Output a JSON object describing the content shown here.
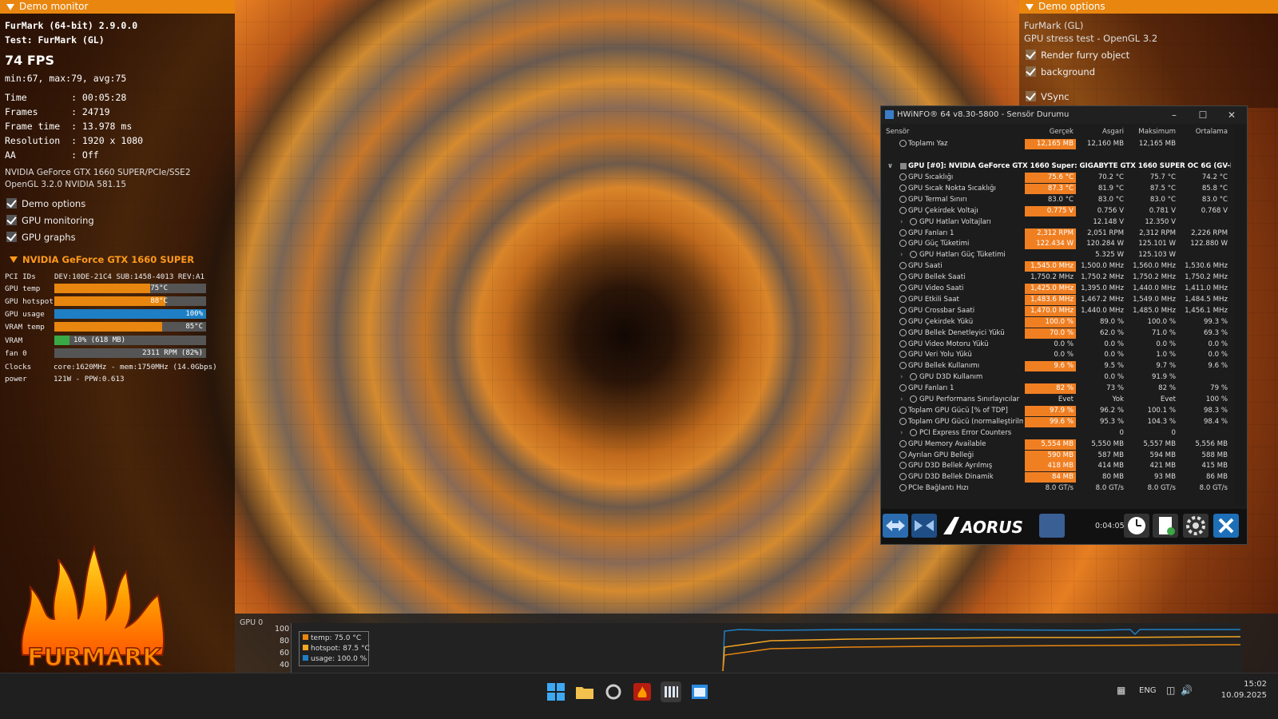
{
  "left_panel": {
    "title": "Demo monitor",
    "app": "FurMark (64-bit) 2.9.0.0",
    "test": "Test: FurMark (GL)",
    "fps": "74 FPS",
    "fps_stats": "min:67, max:79, avg:75",
    "time": "Time        : 00:05:28",
    "frames": "Frames      : 24719",
    "frame_time": "Frame time  : 13.978 ms",
    "resolution": "Resolution  : 1920 x 1080",
    "aa": "AA          : Off",
    "gpu_info": "NVIDIA GeForce GTX 1660 SUPER/PCIe/SSE2",
    "gl_info": "OpenGL 3.2.0 NVIDIA 581.15",
    "checks": [
      "Demo options",
      "GPU monitoring",
      "GPU graphs"
    ],
    "gpu_header": "NVIDIA GeForce GTX 1660 SUPER",
    "pci_label": "PCI IDs",
    "pci_value": "DEV:10DE-21C4 SUB:1458-4013 REV:A1",
    "bars": [
      {
        "label": "GPU temp",
        "text": "75°C",
        "fill": 0.63,
        "color": "#e8860f"
      },
      {
        "label": "GPU hotspot",
        "text": "88°C",
        "fill": 0.73,
        "color": "#e8860f"
      },
      {
        "label": "GPU usage",
        "text": "100%",
        "fill": 1.0,
        "color": "#1f7fc4"
      },
      {
        "label": "VRAM temp",
        "text": "85°C",
        "fill": 0.71,
        "color": "#e8860f"
      },
      {
        "label": "VRAM",
        "text": "10% (618 MB)",
        "fill": 0.1,
        "color": "#3aa845"
      },
      {
        "label": "fan 0",
        "text": "2311 RPM (82%)",
        "fill": 0.0,
        "color": "#777"
      }
    ],
    "clocks_label": "Clocks",
    "clocks_value": "core:1620MHz - mem:1750MHz (14.0Gbps)",
    "power_label": "power",
    "power_value": "121W - PPW:0.613",
    "logo_text": "FURMARK"
  },
  "right_panel": {
    "title": "Demo options",
    "line1": "FurMark (GL)",
    "line2": "GPU stress test - OpenGL 3.2",
    "checks": [
      "Render furry object",
      "background",
      "VSync"
    ]
  },
  "hwinfo": {
    "title": "HWiNFO® 64 v8.30-5800 - Sensör Durumu",
    "columns": [
      "Sensör",
      "Gerçek",
      "Asgari",
      "Maksimum",
      "Ortalama"
    ],
    "top_row": {
      "name": "Toplamı Yaz",
      "vals": [
        "12,165 MB",
        "12,160 MB",
        "12,165 MB",
        ""
      ]
    },
    "group": "GPU [#0]: NVIDIA GeForce GTX 1660 Super: GIGABYTE GTX 1660 SUPER OC 6G (GV-N16...",
    "rows": [
      {
        "name": "GPU Sıcaklığı",
        "vals": [
          "75.6 °C",
          "70.2 °C",
          "75.7 °C",
          "74.2 °C"
        ],
        "hl": true
      },
      {
        "name": "GPU Sıcak Nokta Sıcaklığı",
        "vals": [
          "87.3 °C",
          "81.9 °C",
          "87.5 °C",
          "85.8 °C"
        ],
        "hl": true
      },
      {
        "name": "GPU Termal Sınırı",
        "vals": [
          "83.0 °C",
          "83.0 °C",
          "83.0 °C",
          "83.0 °C"
        ],
        "hl": false
      },
      {
        "name": "GPU Çekirdek Voltajı",
        "vals": [
          "0.775 V",
          "0.756 V",
          "0.781 V",
          "0.768 V"
        ],
        "hl": true
      },
      {
        "name": "GPU Hatları Voltajları",
        "vals": [
          "",
          "12.148 V",
          "12.350 V",
          ""
        ],
        "hl": false,
        "sub": true
      },
      {
        "name": "GPU Fanları 1",
        "vals": [
          "2,312 RPM",
          "2,051 RPM",
          "2,312 RPM",
          "2,226 RPM"
        ],
        "hl": true
      },
      {
        "name": "GPU Güç Tüketimi",
        "vals": [
          "122.434 W",
          "120.284 W",
          "125.101 W",
          "122.880 W"
        ],
        "hl": true
      },
      {
        "name": "GPU Hatları Güç Tüketimi",
        "vals": [
          "",
          "5.325 W",
          "125.103 W",
          ""
        ],
        "hl": false,
        "sub": true
      },
      {
        "name": "GPU Saati",
        "vals": [
          "1,545.0 MHz",
          "1,500.0 MHz",
          "1,560.0 MHz",
          "1,530.6 MHz"
        ],
        "hl": true
      },
      {
        "name": "GPU Bellek Saati",
        "vals": [
          "1,750.2 MHz",
          "1,750.2 MHz",
          "1,750.2 MHz",
          "1,750.2 MHz"
        ],
        "hl": false
      },
      {
        "name": "GPU Video Saati",
        "vals": [
          "1,425.0 MHz",
          "1,395.0 MHz",
          "1,440.0 MHz",
          "1,411.0 MHz"
        ],
        "hl": true
      },
      {
        "name": "GPU Etkili Saat",
        "vals": [
          "1,483.6 MHz",
          "1,467.2 MHz",
          "1,549.0 MHz",
          "1,484.5 MHz"
        ],
        "hl": true
      },
      {
        "name": "GPU Crossbar Saati",
        "vals": [
          "1,470.0 MHz",
          "1,440.0 MHz",
          "1,485.0 MHz",
          "1,456.1 MHz"
        ],
        "hl": true
      },
      {
        "name": "GPU Çekirdek Yükü",
        "vals": [
          "100.0 %",
          "89.0 %",
          "100.0 %",
          "99.3 %"
        ],
        "hl": true
      },
      {
        "name": "GPU Bellek Denetleyici Yükü",
        "vals": [
          "70.0 %",
          "62.0 %",
          "71.0 %",
          "69.3 %"
        ],
        "hl": true
      },
      {
        "name": "GPU Video Motoru Yükü",
        "vals": [
          "0.0 %",
          "0.0 %",
          "0.0 %",
          "0.0 %"
        ],
        "hl": false
      },
      {
        "name": "GPU Veri Yolu Yükü",
        "vals": [
          "0.0 %",
          "0.0 %",
          "1.0 %",
          "0.0 %"
        ],
        "hl": false
      },
      {
        "name": "GPU Bellek Kullanımı",
        "vals": [
          "9.6 %",
          "9.5 %",
          "9.7 %",
          "9.6 %"
        ],
        "hl": true
      },
      {
        "name": "GPU D3D Kullanım",
        "vals": [
          "",
          "0.0 %",
          "91.9 %",
          ""
        ],
        "hl": false,
        "sub": true
      },
      {
        "name": "GPU Fanları 1",
        "vals": [
          "82 %",
          "73 %",
          "82 %",
          "79 %"
        ],
        "hl": true
      },
      {
        "name": "GPU Performans Sınırlayıcılar",
        "vals": [
          "Evet",
          "Yok",
          "Evet",
          "100 %"
        ],
        "hl": false,
        "sub": true
      },
      {
        "name": "Toplam GPU Gücü [% of TDP]",
        "vals": [
          "97.9 %",
          "96.2 %",
          "100.1 %",
          "98.3 %"
        ],
        "hl": true
      },
      {
        "name": "Toplam GPU Gücü (normalleştirilm...",
        "vals": [
          "99.6 %",
          "95.3 %",
          "104.3 %",
          "98.4 %"
        ],
        "hl": true
      },
      {
        "name": "PCI Express Error Counters",
        "vals": [
          "",
          "0",
          "0",
          ""
        ],
        "hl": false,
        "sub": true
      },
      {
        "name": "GPU Memory Available",
        "vals": [
          "5,554 MB",
          "5,550 MB",
          "5,557 MB",
          "5,556 MB"
        ],
        "hl": true
      },
      {
        "name": "Ayrılan GPU Belleği",
        "vals": [
          "590 MB",
          "587 MB",
          "594 MB",
          "588 MB"
        ],
        "hl": true
      },
      {
        "name": "GPU D3D Bellek Ayrılmış",
        "vals": [
          "418 MB",
          "414 MB",
          "421 MB",
          "415 MB"
        ],
        "hl": true
      },
      {
        "name": "GPU D3D Bellek Dinamik",
        "vals": [
          "84 MB",
          "80 MB",
          "93 MB",
          "86 MB"
        ],
        "hl": true
      },
      {
        "name": "PCIe Bağlantı Hızı",
        "vals": [
          "8.0 GT/s",
          "8.0 GT/s",
          "8.0 GT/s",
          "8.0 GT/s"
        ],
        "hl": false
      }
    ],
    "elapsed": "0:04:05",
    "brand": "AORUS"
  },
  "graph": {
    "label": "GPU 0",
    "yticks": [
      "100",
      "80",
      "60",
      "40"
    ],
    "legend": [
      {
        "text": "temp: 75.0 °C",
        "color": "#e8860f"
      },
      {
        "text": "hotspot: 87.5 °C",
        "color": "#f5a623"
      },
      {
        "text": "usage: 100.0 %",
        "color": "#1f7fc4"
      }
    ]
  },
  "taskbar": {
    "lang": "ENG",
    "time": "15:02",
    "date": "10.09.2025"
  }
}
